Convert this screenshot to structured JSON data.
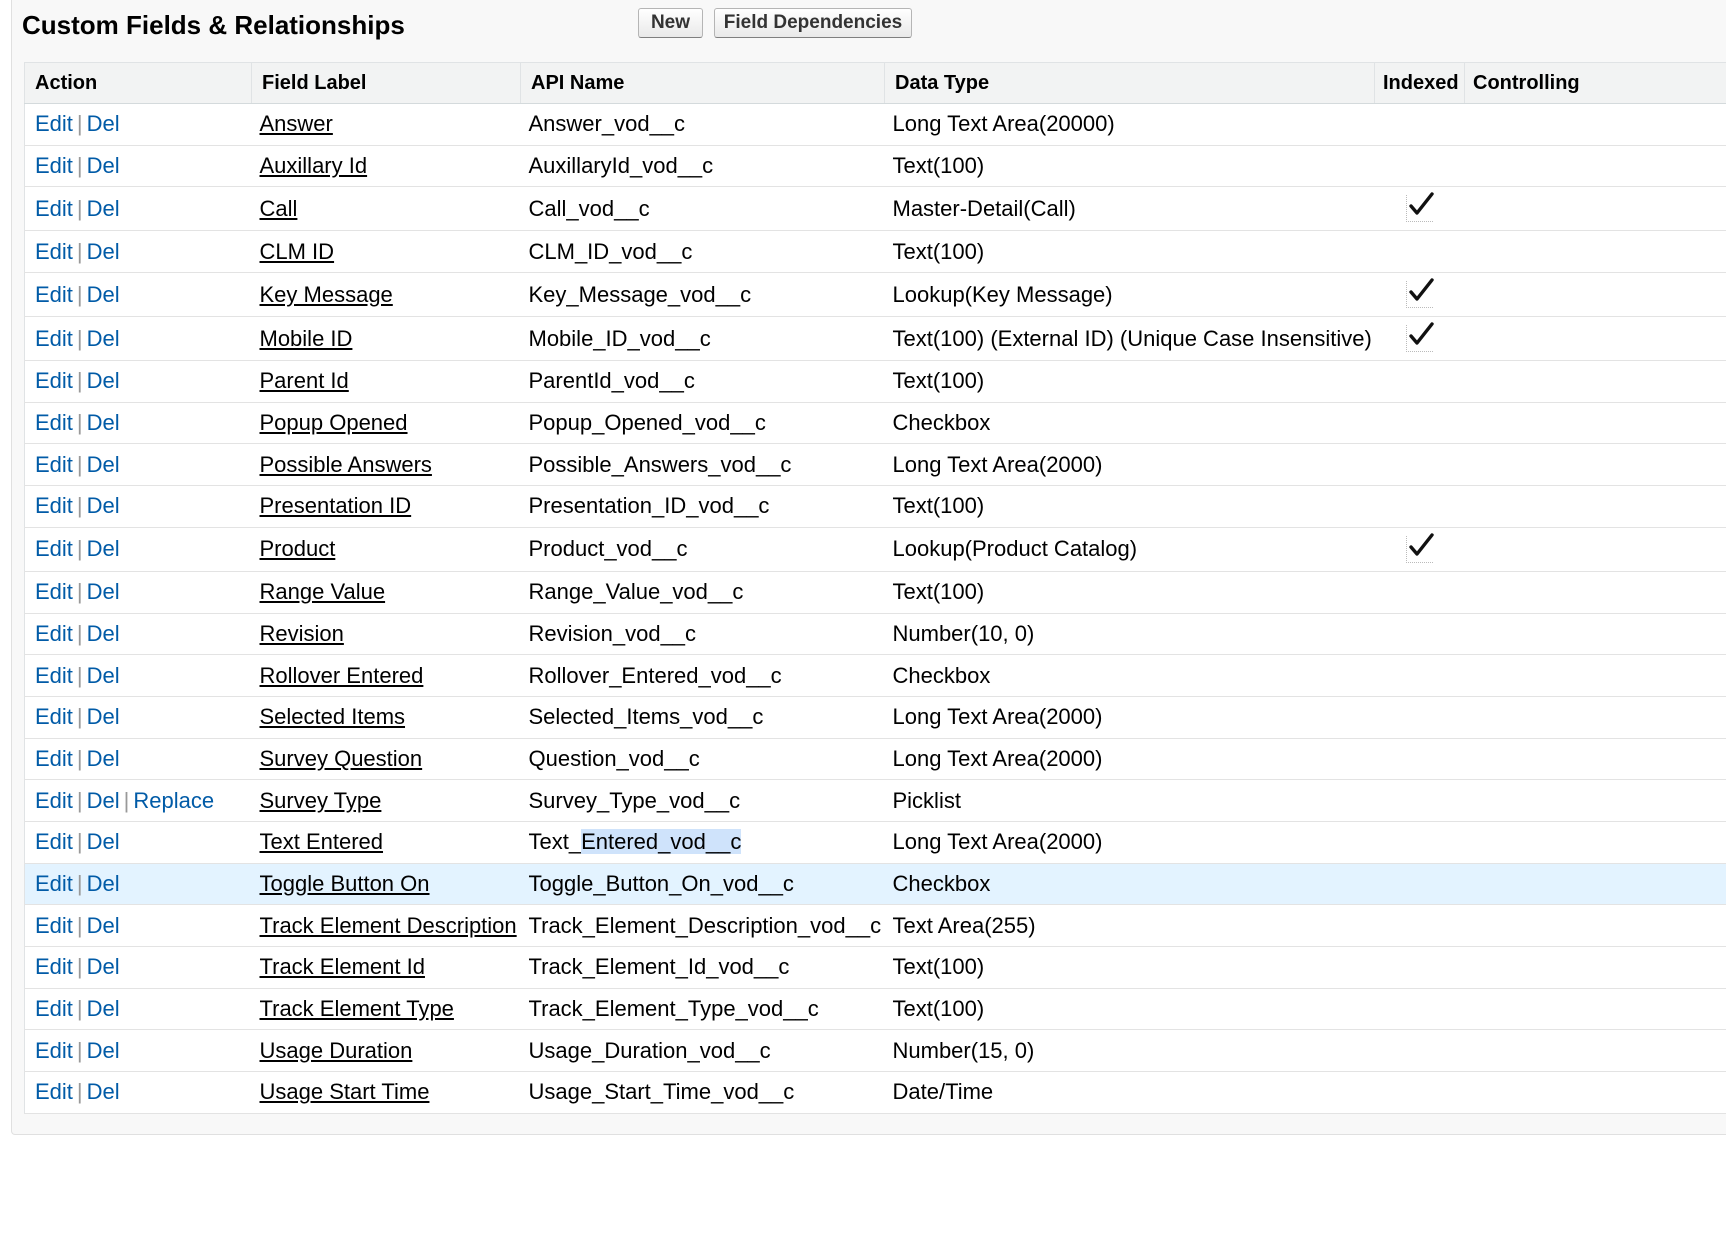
{
  "header": {
    "title": "Custom Fields & Relationships",
    "new_label": "New",
    "dependencies_label": "Field Dependencies"
  },
  "columns": {
    "action": "Action",
    "label": "Field Label",
    "api": "API Name",
    "type": "Data Type",
    "indexed": "Indexed",
    "controlling": "Controlling"
  },
  "actions": {
    "edit": "Edit",
    "del": "Del",
    "replace": "Replace",
    "separator": "|"
  },
  "rows": [
    {
      "label": "Answer",
      "api": "Answer_vod__c",
      "type": "Long Text Area(20000)",
      "indexed": false
    },
    {
      "label": "Auxillary Id",
      "api": "AuxillaryId_vod__c",
      "type": "Text(100)",
      "indexed": false
    },
    {
      "label": "Call",
      "api": "Call_vod__c",
      "type": "Master-Detail(Call)",
      "indexed": true
    },
    {
      "label": "CLM ID",
      "api": "CLM_ID_vod__c",
      "type": "Text(100)",
      "indexed": false
    },
    {
      "label": "Key Message",
      "api": "Key_Message_vod__c",
      "type": "Lookup(Key Message)",
      "indexed": true
    },
    {
      "label": "Mobile ID",
      "api": "Mobile_ID_vod__c",
      "type": "Text(100) (External ID) (Unique Case Insensitive)",
      "indexed": true
    },
    {
      "label": "Parent Id",
      "api": "ParentId_vod__c",
      "type": "Text(100)",
      "indexed": false
    },
    {
      "label": "Popup Opened",
      "api": "Popup_Opened_vod__c",
      "type": "Checkbox",
      "indexed": false
    },
    {
      "label": "Possible Answers",
      "api": "Possible_Answers_vod__c",
      "type": "Long Text Area(2000)",
      "indexed": false
    },
    {
      "label": "Presentation ID",
      "api": "Presentation_ID_vod__c",
      "type": "Text(100)",
      "indexed": false
    },
    {
      "label": "Product",
      "api": "Product_vod__c",
      "type": "Lookup(Product Catalog)",
      "indexed": true
    },
    {
      "label": "Range Value",
      "api": "Range_Value_vod__c",
      "type": "Text(100)",
      "indexed": false
    },
    {
      "label": "Revision",
      "api": "Revision_vod__c",
      "type": "Number(10, 0)",
      "indexed": false
    },
    {
      "label": "Rollover Entered",
      "api": "Rollover_Entered_vod__c",
      "type": "Checkbox",
      "indexed": false
    },
    {
      "label": "Selected Items",
      "api": "Selected_Items_vod__c",
      "type": "Long Text Area(2000)",
      "indexed": false
    },
    {
      "label": "Survey Question",
      "api": "Question_vod__c",
      "type": "Long Text Area(2000)",
      "indexed": false
    },
    {
      "label": "Survey Type",
      "api": "Survey_Type_vod__c",
      "type": "Picklist",
      "indexed": false,
      "replace": true
    },
    {
      "label": "Text Entered",
      "api_prefix": "Text_",
      "api_selected": "Entered_vod__c",
      "api": "Text_Entered_vod__c",
      "type": "Long Text Area(2000)",
      "indexed": false
    },
    {
      "label": "Toggle Button On",
      "api": "Toggle_Button_On_vod__c",
      "type": "Checkbox",
      "indexed": false,
      "hover": true
    },
    {
      "label": "Track Element Description",
      "api": "Track_Element_Description_vod__c",
      "type": "Text Area(255)",
      "indexed": false
    },
    {
      "label": "Track Element Id",
      "api": "Track_Element_Id_vod__c",
      "type": "Text(100)",
      "indexed": false
    },
    {
      "label": "Track Element Type",
      "api": "Track_Element_Type_vod__c",
      "type": "Text(100)",
      "indexed": false
    },
    {
      "label": "Usage Duration",
      "api": "Usage_Duration_vod__c",
      "type": "Number(15, 0)",
      "indexed": false
    },
    {
      "label": "Usage Start Time",
      "api": "Usage_Start_Time_vod__c",
      "type": "Date/Time",
      "indexed": false
    }
  ]
}
